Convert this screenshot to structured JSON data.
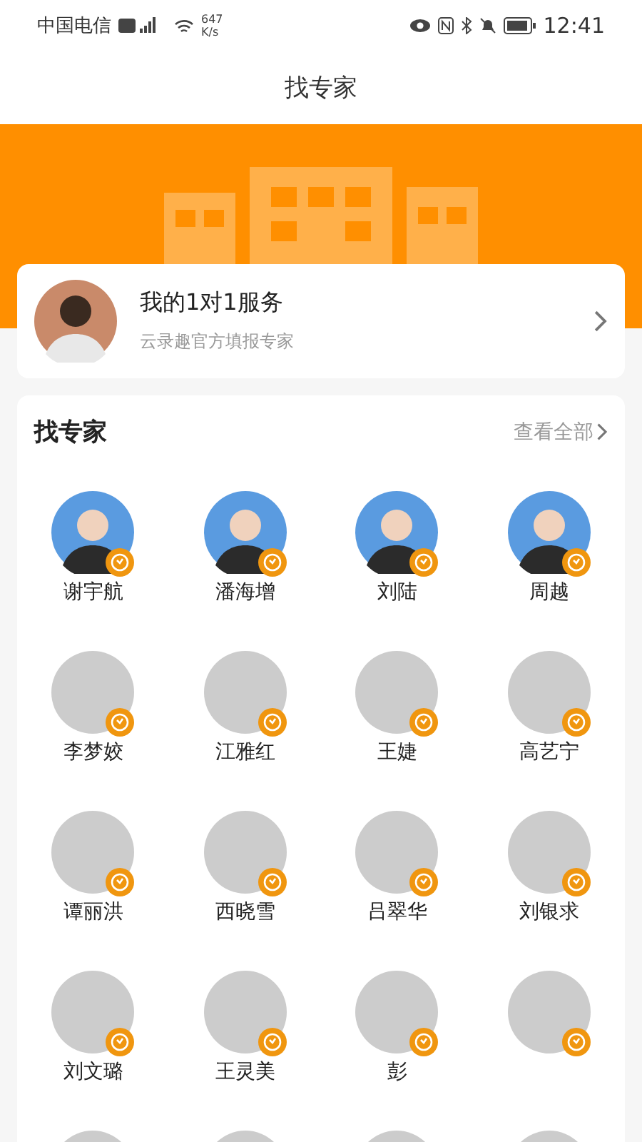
{
  "status_bar": {
    "carrier": "中国电信",
    "speed": "647",
    "speed_unit": "K/s",
    "time": "12:41"
  },
  "header": {
    "title": "找专家"
  },
  "service_card": {
    "title": "我的1对1服务",
    "subtitle": "云录趣官方填报专家"
  },
  "experts_section": {
    "title": "找专家",
    "view_all": "查看全部",
    "experts": [
      {
        "name": "谢宇航",
        "kind": "photo"
      },
      {
        "name": "潘海增",
        "kind": "photo"
      },
      {
        "name": "刘陆",
        "kind": "photo"
      },
      {
        "name": "周越",
        "kind": "photo"
      },
      {
        "name": "李梦姣",
        "kind": "placeholder"
      },
      {
        "name": "江雅红",
        "kind": "placeholder"
      },
      {
        "name": "王婕",
        "kind": "placeholder"
      },
      {
        "name": "高艺宁",
        "kind": "placeholder"
      },
      {
        "name": "谭丽洪",
        "kind": "placeholder"
      },
      {
        "name": "西晓雪",
        "kind": "placeholder"
      },
      {
        "name": "吕翠华",
        "kind": "placeholder"
      },
      {
        "name": "刘银求",
        "kind": "placeholder"
      },
      {
        "name": "刘文璐",
        "kind": "placeholder"
      },
      {
        "name": "王灵美",
        "kind": "placeholder"
      },
      {
        "name": "彭",
        "kind": "placeholder"
      },
      {
        "kind": "placeholder"
      },
      {
        "kind": "partial"
      },
      {
        "kind": "partial"
      },
      {
        "kind": "partial"
      },
      {
        "kind": "partial"
      }
    ]
  }
}
